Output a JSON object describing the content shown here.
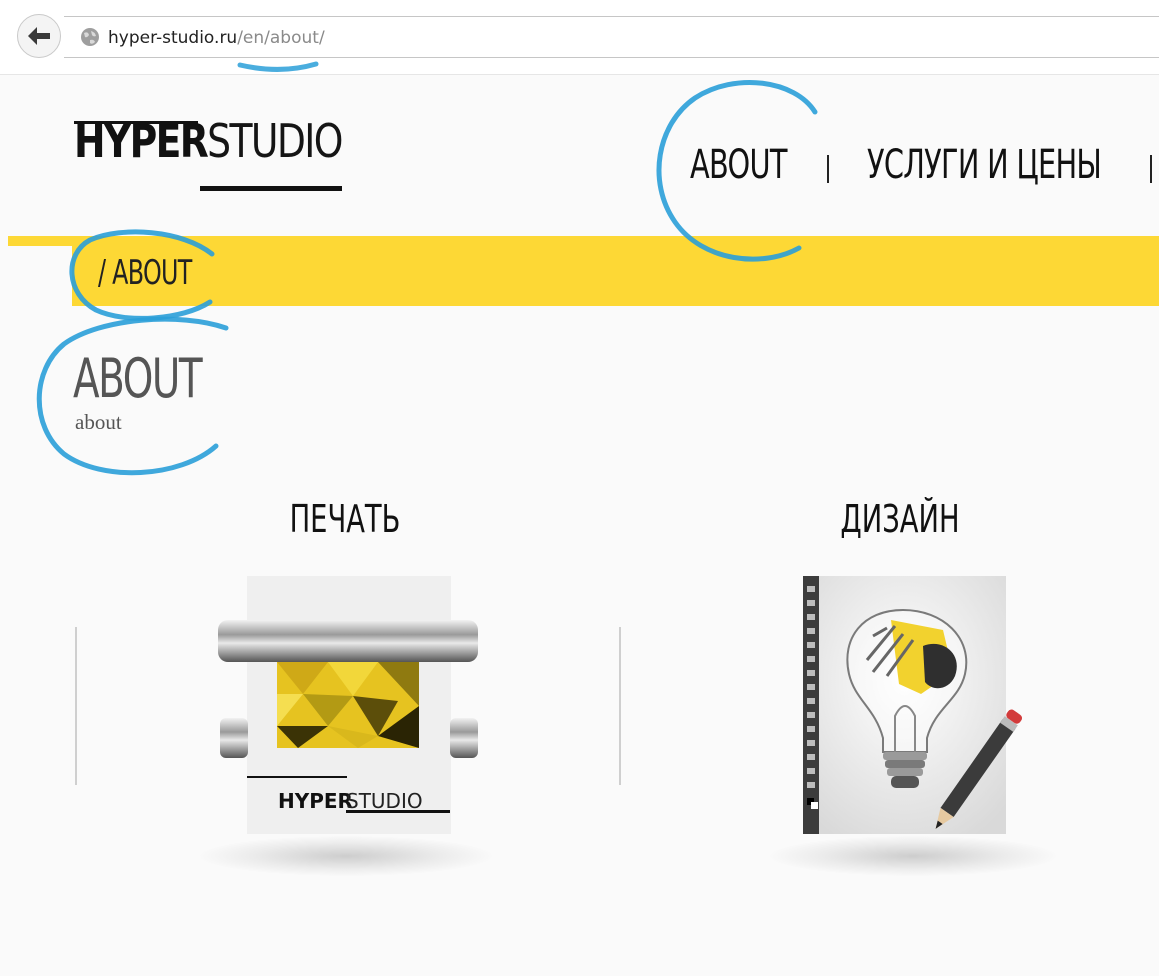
{
  "browser": {
    "url_domain": "hyper-studio.ru",
    "url_path": "/en/about/",
    "back_icon": "arrow-left-icon",
    "site_icon": "globe-icon"
  },
  "header": {
    "logo_bold": "HYPER",
    "logo_thin": "STUDIO",
    "nav": [
      {
        "label": "ABOUT"
      },
      {
        "label": "УСЛУГИ И ЦЕНЫ"
      }
    ]
  },
  "breadcrumb": {
    "text": "/ ABOUT"
  },
  "page": {
    "title": "ABOUT",
    "subtitle": "about"
  },
  "services": [
    {
      "title": "ПЕЧАТЬ",
      "image_icon": "printer-rollers-icon",
      "image_logo_bold": "HYPER",
      "image_logo_thin": "STUDIO"
    },
    {
      "title": "ДИЗАЙН",
      "image_icon": "lightbulb-pencil-icon"
    }
  ],
  "colors": {
    "accent_yellow": "#fdd835",
    "annotation_blue": "#2a9fd8",
    "text_dark": "#111111",
    "text_gray": "#555555"
  }
}
